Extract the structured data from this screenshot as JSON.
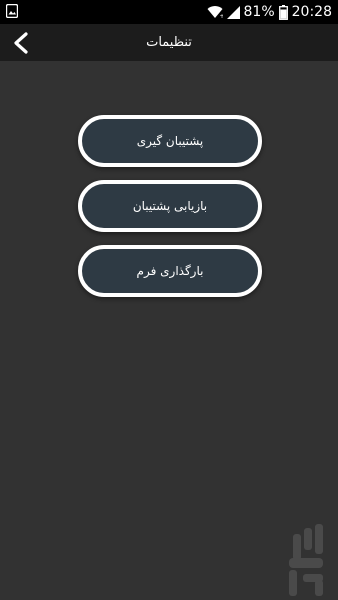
{
  "status_bar": {
    "battery_percent": "81%",
    "time": "20:28",
    "icons": [
      "image-notification-icon",
      "wifi-icon",
      "signal-icon",
      "battery-icon"
    ]
  },
  "toolbar": {
    "title": "تنظیمات",
    "back_icon": "chevron-left-icon"
  },
  "menu": {
    "items": [
      {
        "label": "پشتیبان گیری"
      },
      {
        "label": "بازیابی پشتیبان"
      },
      {
        "label": "بارگذاری فرم"
      }
    ]
  },
  "colors": {
    "background": "#323232",
    "status_bar": "#000000",
    "toolbar": "#1c1c1c",
    "button_fill": "#2e3a44",
    "button_border": "#ffffff",
    "text": "#ffffff"
  },
  "watermark": {
    "icon": "app-logo-watermark-icon"
  }
}
